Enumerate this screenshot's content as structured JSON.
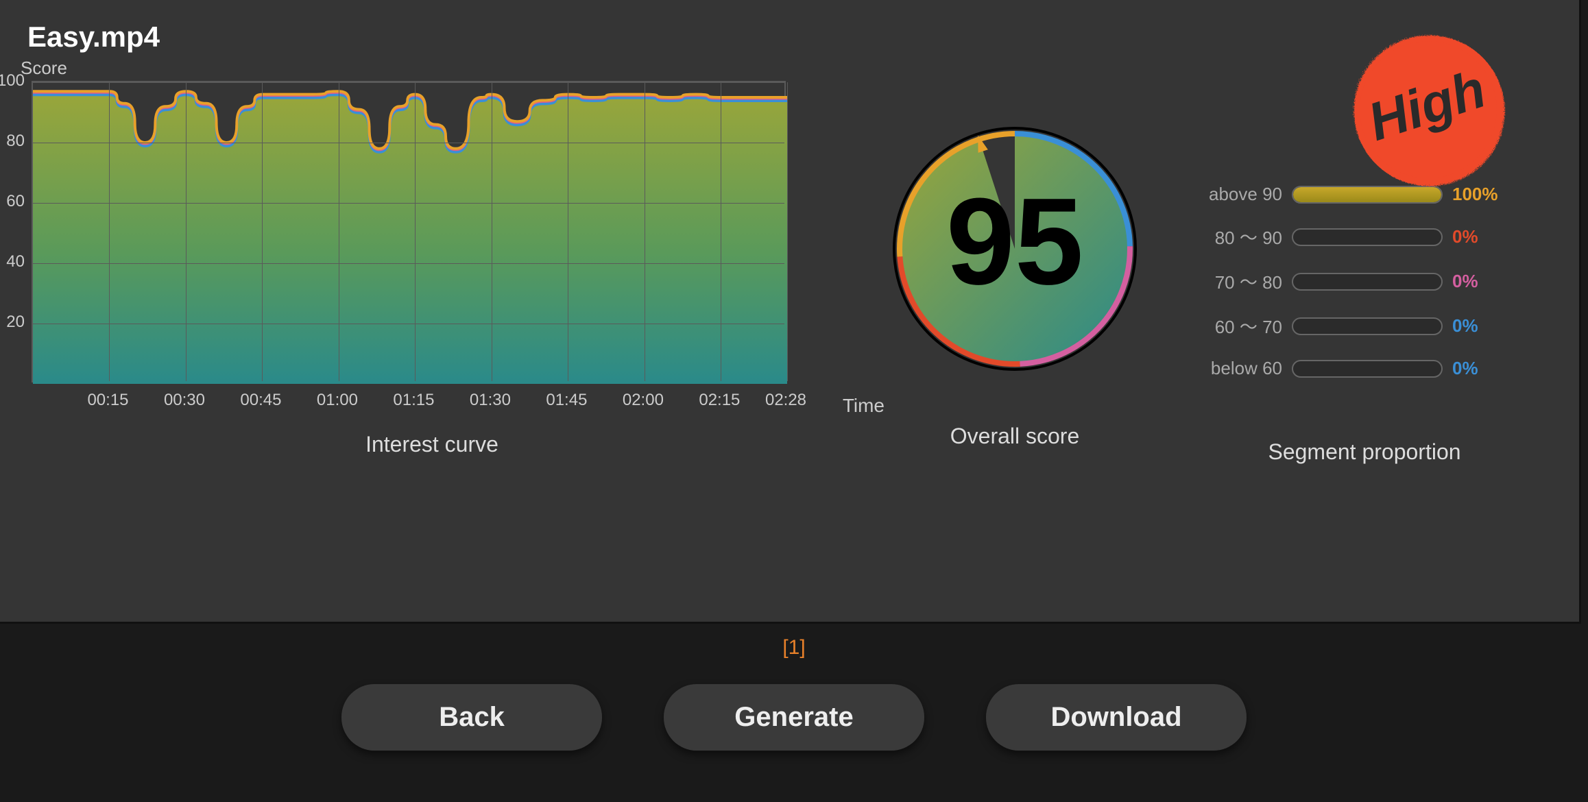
{
  "filename": "Easy.mp4",
  "curve": {
    "ylabel": "Score",
    "xlabel": "Time",
    "title": "Interest curve"
  },
  "gauge": {
    "score": "95",
    "title": "Overall score"
  },
  "badge": {
    "text": "High"
  },
  "segments": {
    "title": "Segment proportion",
    "rows": [
      {
        "label": "above 90",
        "pct": "100%",
        "value": 100,
        "color": "#e8a12a"
      },
      {
        "label": "80 ～ 90",
        "pct": "0%",
        "value": 0,
        "color": "#e24a2a"
      },
      {
        "label": "70 ～ 80",
        "pct": "0%",
        "value": 0,
        "color": "#d45fa0"
      },
      {
        "label": "60 ～ 70",
        "pct": "0%",
        "value": 0,
        "color": "#3a8fd6"
      },
      {
        "label": "below 60",
        "pct": "0%",
        "value": 0,
        "color": "#3a8fd6"
      }
    ]
  },
  "footer": {
    "pager": "[1]",
    "back": "Back",
    "generate": "Generate",
    "download": "Download"
  },
  "chart_data": [
    {
      "type": "area",
      "title": "Interest curve",
      "xlabel": "Time",
      "ylabel": "Score",
      "ylim": [
        0,
        100
      ],
      "yticks": [
        20,
        40,
        60,
        80,
        100
      ],
      "xticks": [
        "00:15",
        "00:30",
        "00:45",
        "01:00",
        "01:15",
        "01:30",
        "01:45",
        "02:00",
        "02:15",
        "02:28"
      ],
      "x_seconds": [
        0,
        5,
        10,
        15,
        18,
        22,
        26,
        30,
        34,
        38,
        42,
        45,
        50,
        55,
        60,
        64,
        68,
        72,
        75,
        79,
        83,
        88,
        90,
        95,
        100,
        105,
        110,
        115,
        120,
        125,
        130,
        135,
        140,
        148
      ],
      "values": [
        97,
        97,
        97,
        97,
        93,
        80,
        92,
        97,
        93,
        80,
        92,
        96,
        96,
        96,
        97,
        91,
        78,
        92,
        96,
        86,
        78,
        95,
        96,
        87,
        94,
        96,
        95,
        96,
        96,
        95,
        96,
        95,
        95,
        95
      ],
      "colors": {
        "line_top": "#e8a12a",
        "line_bottom": "#3a8fd6",
        "fill_top": "#8a9a3a",
        "fill_bottom": "#2a8a8a"
      }
    },
    {
      "type": "pie",
      "title": "Overall score",
      "center_value": 95,
      "slices": [
        {
          "name": "filled",
          "value": 95
        },
        {
          "name": "remaining",
          "value": 5
        }
      ],
      "ring_colors": [
        "#e8a12a",
        "#e24a2a",
        "#d45fa0",
        "#3a8fd6"
      ]
    },
    {
      "type": "bar",
      "title": "Segment proportion",
      "categories": [
        "above 90",
        "80 ～ 90",
        "70 ～ 80",
        "60 ～ 70",
        "below 60"
      ],
      "values": [
        100,
        0,
        0,
        0,
        0
      ],
      "unit": "%"
    }
  ]
}
